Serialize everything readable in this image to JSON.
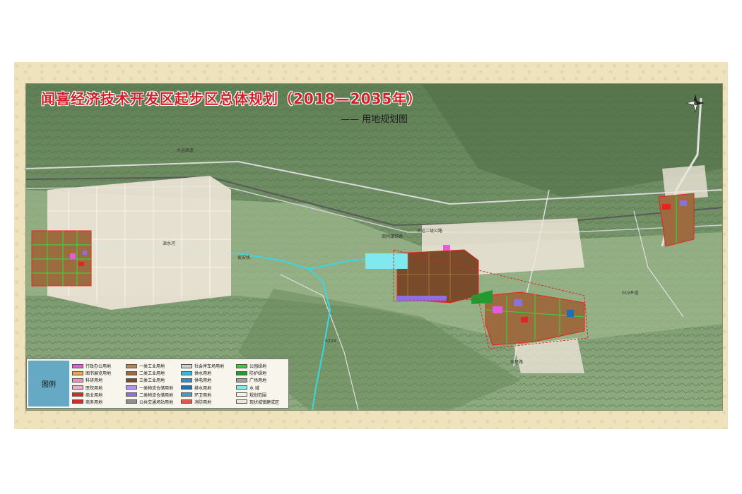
{
  "map": {
    "title": "闻喜经济技术开发区起步区总体规划（2018—2035年）",
    "subtitle": "—— 用地规划图",
    "compass_icon": "north-arrow-icon"
  },
  "road_labels": [
    "大运高速",
    "大运二级公路",
    "南同蒲铁路",
    "侯安线",
    "东环路",
    "涑水河",
    "S329",
    "019乡道"
  ],
  "legend": {
    "title": "图例",
    "columns": [
      [
        {
          "label": "行政办公用地",
          "color": "#e85ad8"
        },
        {
          "label": "图书展览用地",
          "color": "#e6a84f"
        },
        {
          "label": "科研用地",
          "color": "#f08cc0"
        },
        {
          "label": "医院用地",
          "color": "#f3a9c7"
        },
        {
          "label": "商业用地",
          "color": "#e8231f"
        },
        {
          "label": "商务用地",
          "color": "#c8312a"
        }
      ],
      [
        {
          "label": "一类工业用地",
          "color": "#b8864e"
        },
        {
          "label": "二类工业用地",
          "color": "#9c6b3f"
        },
        {
          "label": "三类工业用地",
          "color": "#7a4b2a"
        },
        {
          "label": "一类物流仓储用地",
          "color": "#b693e8"
        },
        {
          "label": "二类物流仓储用地",
          "color": "#8c6fe0"
        },
        {
          "label": "公共交通场站用地",
          "color": "#8f8f8f"
        }
      ],
      [
        {
          "label": "社会停车场用地",
          "color": "#cfcfcf"
        },
        {
          "label": "供水用地",
          "color": "#38b6e6"
        },
        {
          "label": "供电用地",
          "color": "#2a8fd0"
        },
        {
          "label": "排水用地",
          "color": "#2070b0"
        },
        {
          "label": "环卫用地",
          "color": "#3aa0c8"
        },
        {
          "label": "消防用地",
          "color": "#e05a4a"
        }
      ],
      [
        {
          "label": "公园绿地",
          "color": "#3ccf3c"
        },
        {
          "label": "防护绿地",
          "color": "#229a2f"
        },
        {
          "label": "广场用地",
          "color": "#a0a0a0"
        },
        {
          "label": "水    域",
          "color": "#7fe9ef"
        },
        {
          "label": "规划范围",
          "color": "#f0f0f0"
        },
        {
          "label": "现状城镇建成区",
          "color": "#eee5d8"
        }
      ]
    ]
  }
}
